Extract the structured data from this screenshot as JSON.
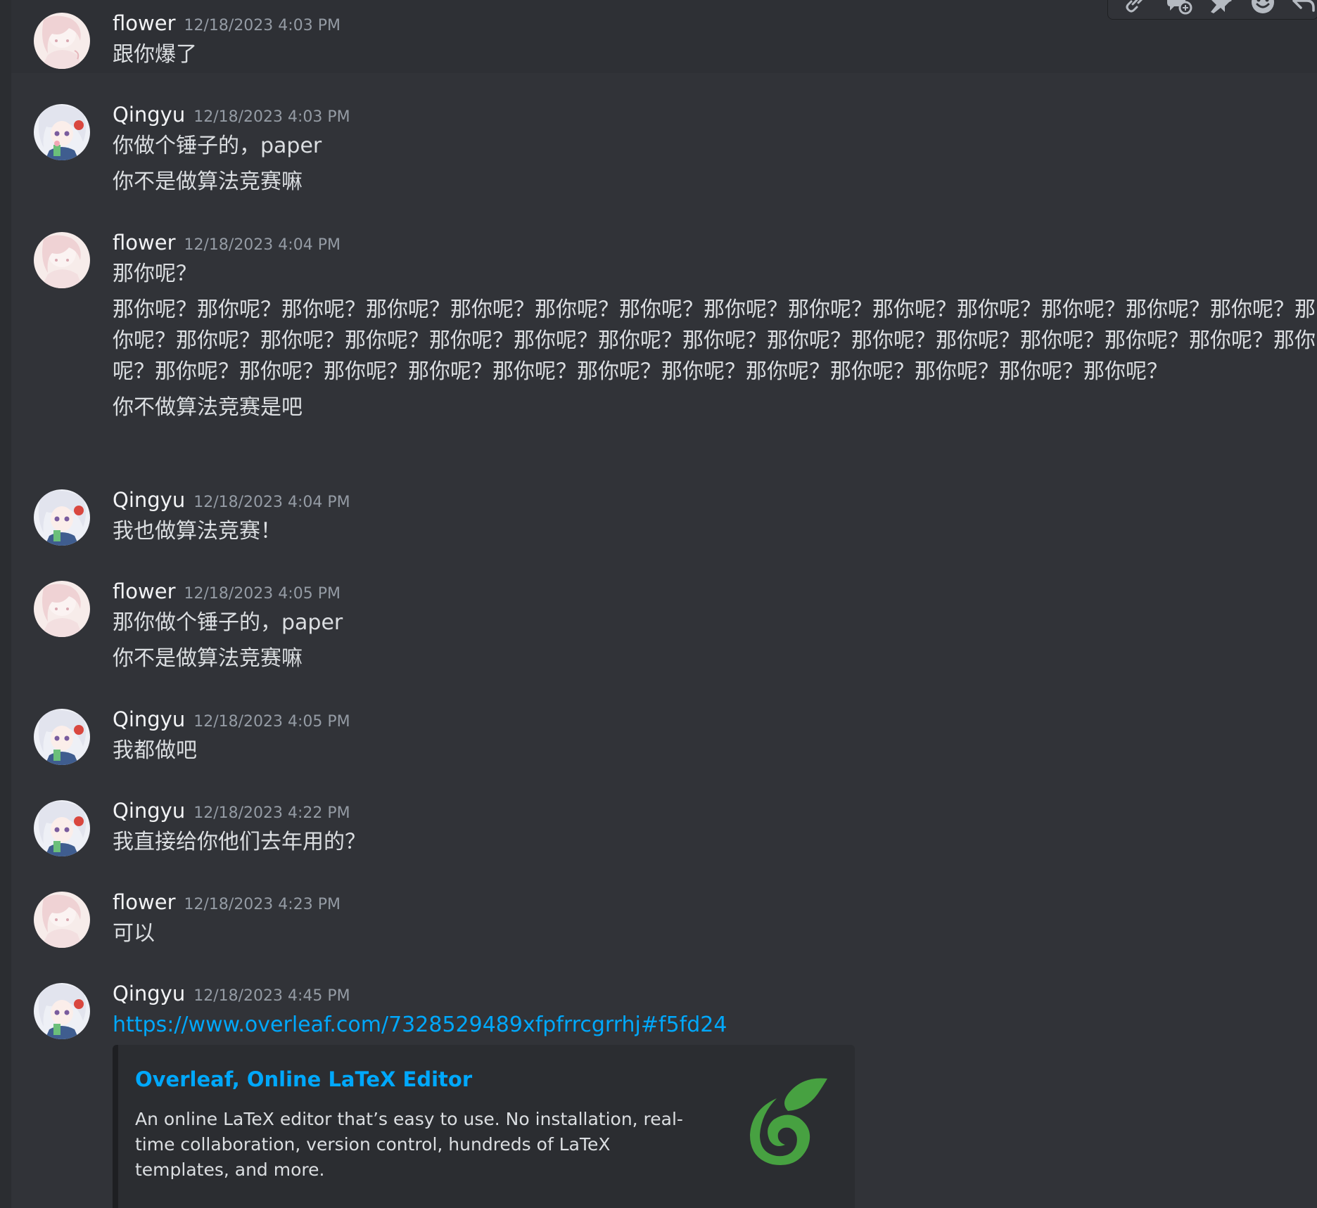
{
  "messages": [
    {
      "author": "flower",
      "timestamp": "12/18/2023 4:03 PM",
      "lines": [
        "跟你爆了"
      ]
    },
    {
      "author": "Qingyu",
      "timestamp": "12/18/2023 4:03 PM",
      "lines": [
        "你做个锤子的，paper",
        "你不是做算法竞赛嘛"
      ]
    },
    {
      "author": "flower",
      "timestamp": "12/18/2023 4:04 PM",
      "lines": [
        "那你呢？",
        "那你呢？那你呢？那你呢？那你呢？那你呢？那你呢？那你呢？那你呢？那你呢？那你呢？那你呢？那你呢？那你呢？那你呢？那你呢？那你呢？那你呢？那你呢？那你呢？那你呢？那你呢？那你呢？那你呢？那你呢？那你呢？那你呢？那你呢？那你呢？那你呢？那你呢？那你呢？那你呢？那你呢？那你呢？那你呢？那你呢？那你呢？那你呢？那你呢？那你呢？那你呢？",
        "你不做算法竞赛是吧"
      ]
    },
    {
      "author": "Qingyu",
      "timestamp": "12/18/2023 4:04 PM",
      "lines": [
        "我也做算法竞赛！"
      ]
    },
    {
      "author": "flower",
      "timestamp": "12/18/2023 4:05 PM",
      "lines": [
        "那你做个锤子的，paper",
        "你不是做算法竞赛嘛"
      ]
    },
    {
      "author": "Qingyu",
      "timestamp": "12/18/2023 4:05 PM",
      "lines": [
        "我都做吧"
      ]
    },
    {
      "author": "Qingyu",
      "timestamp": "12/18/2023 4:22 PM",
      "lines": [
        "我直接给你他们去年用的？"
      ]
    },
    {
      "author": "flower",
      "timestamp": "12/18/2023 4:23 PM",
      "lines": [
        "可以"
      ]
    },
    {
      "author": "Qingyu",
      "timestamp": "12/18/2023 4:45 PM",
      "link": "https://www.overleaf.com/7328529489xfpfrrcgrrhj#f5fd24",
      "embed": {
        "title": "Overleaf, Online LaTeX Editor",
        "description": "An online LaTeX editor that’s easy to use. No installation, real-time collaboration, version control, hundreds of LaTeX templates, and more.",
        "thumbnail_icon": "overleaf-logo-icon",
        "thumbnail_color": "#47a141"
      }
    }
  ],
  "toolbar": {
    "icons": [
      "copy-link-icon",
      "create-thread-icon",
      "pin-icon",
      "add-reaction-icon",
      "reply-icon"
    ]
  },
  "colors": {
    "background": "#313338",
    "link": "#00a8fc",
    "timestamp": "#949ba4",
    "text": "#dbdee1"
  }
}
